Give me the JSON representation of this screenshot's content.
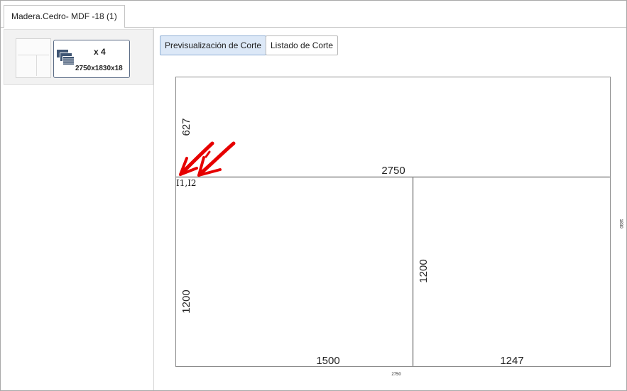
{
  "tabs": [
    {
      "label": "Madera.Cedro- MDF -18 (1)"
    }
  ],
  "board": {
    "quantity": "x 4",
    "dimensions": "2750x1830x18",
    "icon": "board-stack-icon"
  },
  "toolbar": {
    "preview_label": "Previsualización de Corte",
    "list_label": "Listado de Corte"
  },
  "cut_preview": {
    "board_width_label": "2750",
    "board_height_label": "1830",
    "top_strip_height": "627",
    "top_strip_width": "2750",
    "cut_markers": "I1,I2",
    "pieces": [
      {
        "width": "1500",
        "height": "1200"
      },
      {
        "width": "1247",
        "height": "1200"
      }
    ],
    "annotation_color": "#e60000"
  }
}
